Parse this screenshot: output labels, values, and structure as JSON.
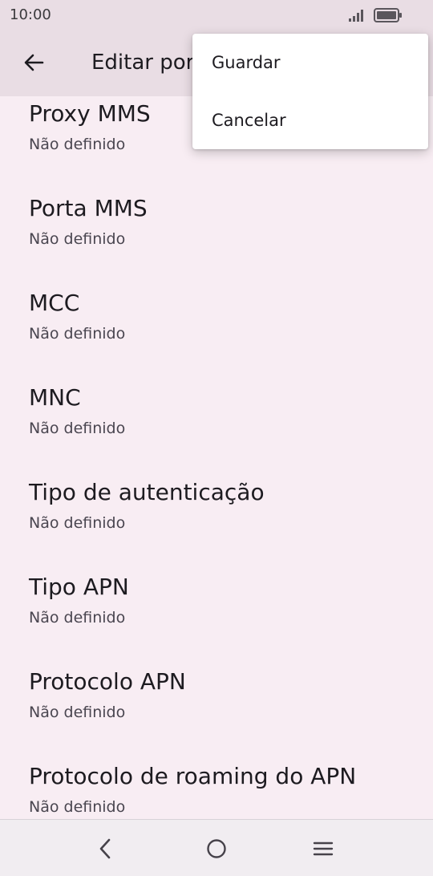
{
  "status_bar": {
    "time": "10:00",
    "icons": [
      "signal-icon",
      "battery-icon"
    ]
  },
  "app_bar": {
    "title": "Editar por"
  },
  "list_items": [
    {
      "title": "Proxy MMS",
      "subtitle": "Não definido"
    },
    {
      "title": "Porta MMS",
      "subtitle": "Não definido"
    },
    {
      "title": "MCC",
      "subtitle": "Não definido"
    },
    {
      "title": "MNC",
      "subtitle": "Não definido"
    },
    {
      "title": "Tipo de autenticação",
      "subtitle": "Não definido"
    },
    {
      "title": "Tipo APN",
      "subtitle": "Não definido"
    },
    {
      "title": "Protocolo APN",
      "subtitle": "Não definido"
    },
    {
      "title": "Protocolo de roaming do APN",
      "subtitle": "Não definido"
    }
  ],
  "overflow_menu": {
    "items": [
      "Guardar",
      "Cancelar"
    ]
  },
  "nav_bar": {
    "icons": [
      "back-icon",
      "home-icon",
      "menu-icon"
    ]
  }
}
